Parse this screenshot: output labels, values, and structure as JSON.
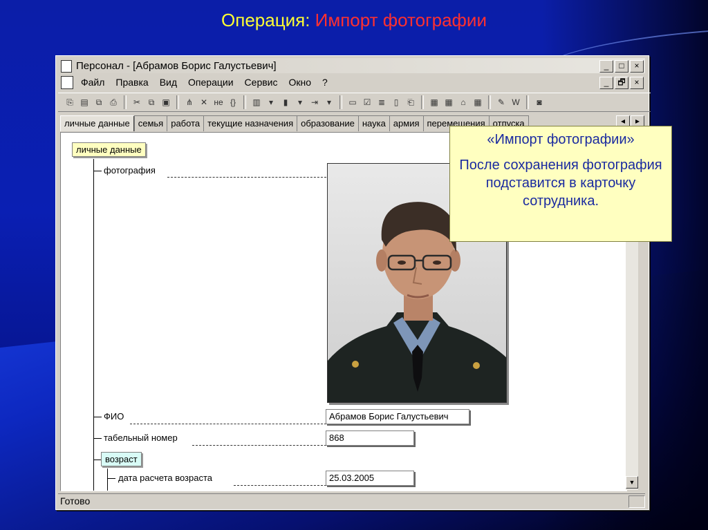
{
  "slide": {
    "title_prefix": "Операция:",
    "title_accent": "Импорт фотографии"
  },
  "window": {
    "title": "Персонал - [Абрамов Борис Галустьевич]",
    "controls": [
      "_",
      "□",
      "×"
    ],
    "mdi_controls": [
      "_",
      "🗗",
      "×"
    ]
  },
  "menu": {
    "items": [
      "Файл",
      "Правка",
      "Вид",
      "Операции",
      "Сервис",
      "Окно",
      "?"
    ]
  },
  "toolbar": {
    "groups": [
      [
        "open-icon",
        "save-icon",
        "copy-doc-icon",
        "print-icon"
      ],
      [
        "cut-icon",
        "copy-icon",
        "paste-icon"
      ],
      [
        "tree-icon",
        "delete-icon",
        "not-icon",
        "brackets-icon"
      ],
      [
        "insert-icon",
        "dropdown-icon",
        "book-icon",
        "dropdown-icon",
        "export-icon",
        "dropdown-icon"
      ],
      [
        "doc-icon",
        "check-doc-icon",
        "stack-icon",
        "form-icon",
        "label-icon"
      ],
      [
        "table-icon",
        "calc-icon",
        "folder-open-icon",
        "grid-icon"
      ],
      [
        "edit-icon",
        "word-icon"
      ],
      [
        "camera-icon"
      ]
    ],
    "glyphs": [
      "⎘",
      "▤",
      "⧉",
      "⎙",
      "✂",
      "⧉",
      "▣",
      "⋔",
      "✕",
      "не",
      "{}",
      "▥",
      "▾",
      "▮",
      "▾",
      "⇥",
      "▾",
      "▭",
      "☑",
      "≣",
      "▯",
      "⎗",
      "▦",
      "▦",
      "⌂",
      "▦",
      "✎",
      "W",
      "◙"
    ]
  },
  "tabs": [
    "личные данные",
    "семья",
    "работа",
    "текущие назначения",
    "образование",
    "наука",
    "армия",
    "перемещения",
    "отпуска"
  ],
  "tree": {
    "root": "личные данные",
    "photo_label": "фотография",
    "fio_label": "ФИО",
    "fio_value": "Абрамов Борис Галустьевич",
    "tab_label": "табельный номер",
    "tab_value": "868",
    "age_label": "возраст",
    "age_date_label": "дата расчета возраста",
    "age_date_value": "25.03.2005"
  },
  "status": {
    "text": "Готово"
  },
  "callout": {
    "title": "«Импорт фотографии»",
    "body": "После сохранения фотография подставится в карточку сотрудника."
  }
}
